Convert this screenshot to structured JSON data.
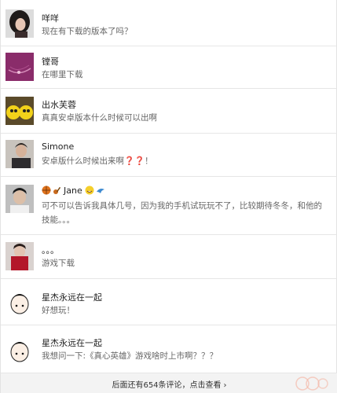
{
  "comments": [
    {
      "user": "咩咩",
      "text": "现在有下载的版本了吗？",
      "avatar": "avatar-woman-dark-hair"
    },
    {
      "user": "镗哥",
      "text": "在哪里下载",
      "avatar": "avatar-purple-cord"
    },
    {
      "user": "出水芙蓉",
      "text": "真真安卓版本什么时候可以出啊",
      "avatar": "avatar-yellow-cartoon"
    },
    {
      "user": "Simone",
      "text": "安卓版什么时候出来啊",
      "text_suffix": "！",
      "avatar": "avatar-man-dark"
    },
    {
      "user": "Jane",
      "text": "可不可以告诉我具体几号，因为我的手机试玩玩不了，比较期待冬冬，和他的技能。。。",
      "avatar": "avatar-young-man"
    },
    {
      "user": "。。。",
      "text": "游戏下载",
      "avatar": "avatar-red-scarf"
    },
    {
      "user": "星杰永远在一起",
      "text": "好想玩！",
      "avatar": "avatar-cartoon-boy"
    },
    {
      "user": "星杰永远在一起",
      "text": "我想问一下:《真心英雄》游戏啥时上市啊？？？",
      "avatar": "avatar-cartoon-boy"
    }
  ],
  "footer": {
    "more_label": "后面还有654条评论，点击查看",
    "chevron": "›"
  },
  "colors": {
    "accent_red": "#d9262a",
    "muted_text": "#666666",
    "footer_bg": "#f3f3f3"
  }
}
